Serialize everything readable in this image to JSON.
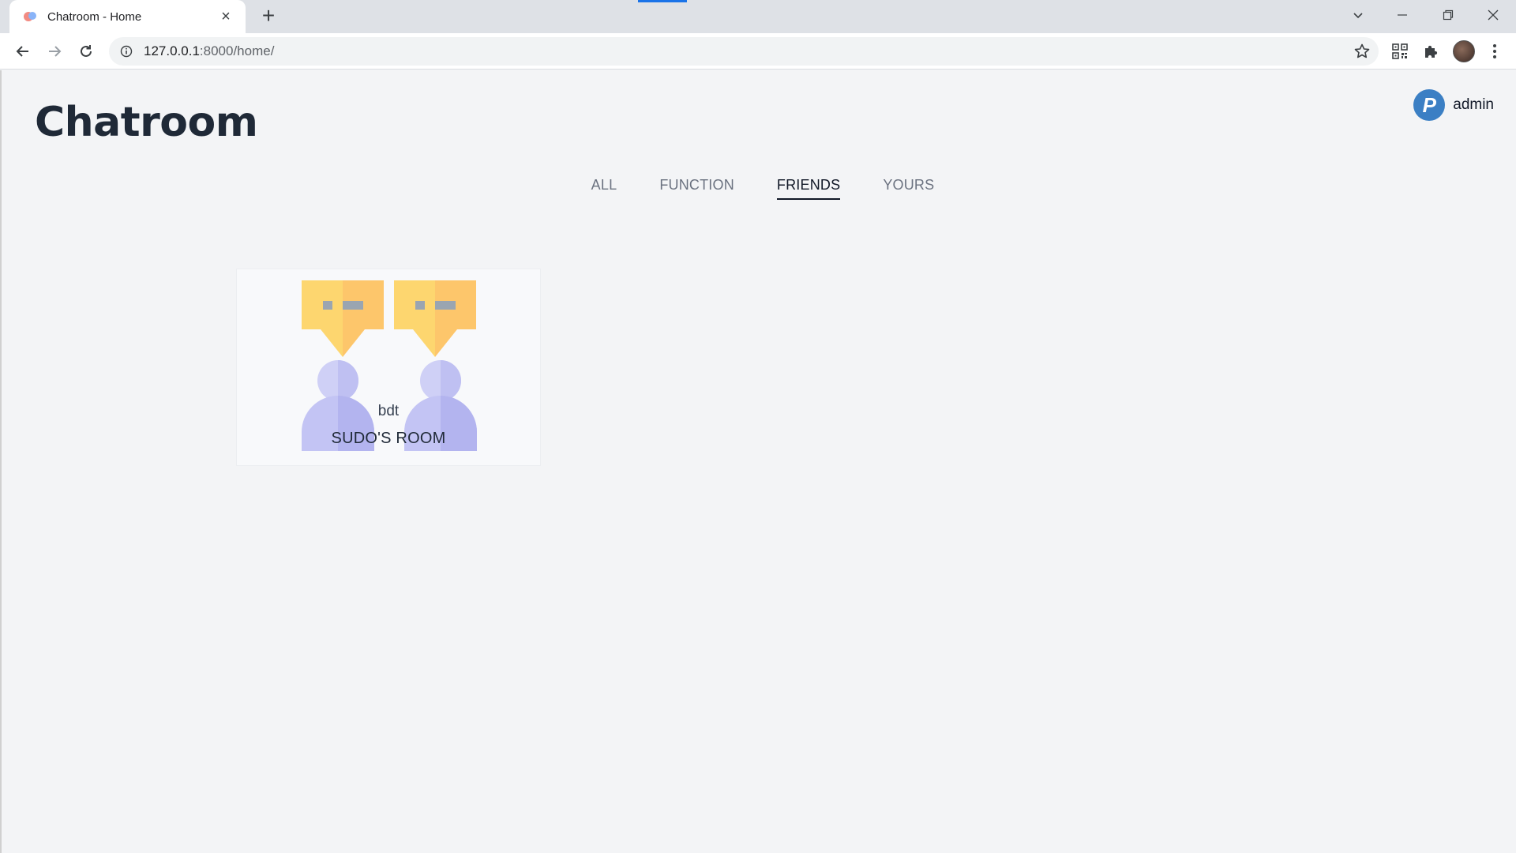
{
  "browser": {
    "tab_title": "Chatroom - Home",
    "url_host": "127.0.0.1",
    "url_rest": ":8000/home/"
  },
  "app": {
    "title": "Chatroom",
    "user": {
      "name": "admin",
      "logo_letter": "P"
    }
  },
  "tabs": [
    {
      "label": "ALL",
      "active": false
    },
    {
      "label": "FUNCTION",
      "active": false
    },
    {
      "label": "FRIENDS",
      "active": true
    },
    {
      "label": "YOURS",
      "active": false
    }
  ],
  "rooms": [
    {
      "owner": "bdt",
      "name": "SUDO'S ROOM"
    }
  ],
  "colors": {
    "accent": "#1a73e8",
    "bubble": "#fdd66f",
    "person": "#c3c4f4"
  }
}
